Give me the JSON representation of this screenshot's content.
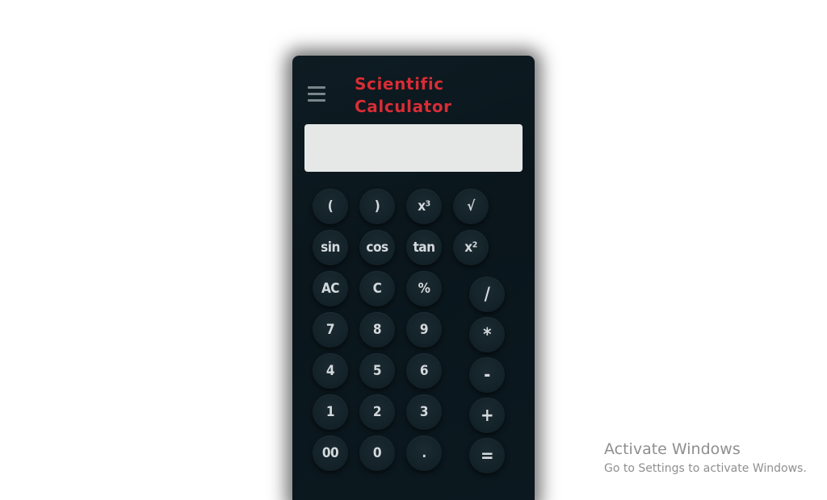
{
  "app": {
    "title": "Scientific Calculator",
    "title_line1": "Scientific",
    "title_line2": "Calculator",
    "menu_icon": "hamburger-menu-icon"
  },
  "display": {
    "value": ""
  },
  "keys": {
    "open_paren": "(",
    "close_paren": ")",
    "cube": "x³",
    "sqrt": "√",
    "sin": "sin",
    "cos": "cos",
    "tan": "tan",
    "square": "x²",
    "all_clear": "AC",
    "clear": "C",
    "percent": "%",
    "divide": "/",
    "multiply": "*",
    "subtract": "-",
    "add": "+",
    "equals": "=",
    "digit_7": "7",
    "digit_8": "8",
    "digit_9": "9",
    "digit_4": "4",
    "digit_5": "5",
    "digit_6": "6",
    "digit_1": "1",
    "digit_2": "2",
    "digit_3": "3",
    "double_zero": "00",
    "digit_0": "0",
    "decimal": "."
  },
  "watermark": {
    "title": "Activate Windows",
    "subtitle": "Go to Settings to activate Windows."
  },
  "colors": {
    "body_bg": "#ffffff",
    "calc_bg": "#0c1a20",
    "title": "#d72d36",
    "display_bg": "#e6e8e8",
    "key_text": "#d4d9dc",
    "watermark_text": "#8f8f8f"
  }
}
